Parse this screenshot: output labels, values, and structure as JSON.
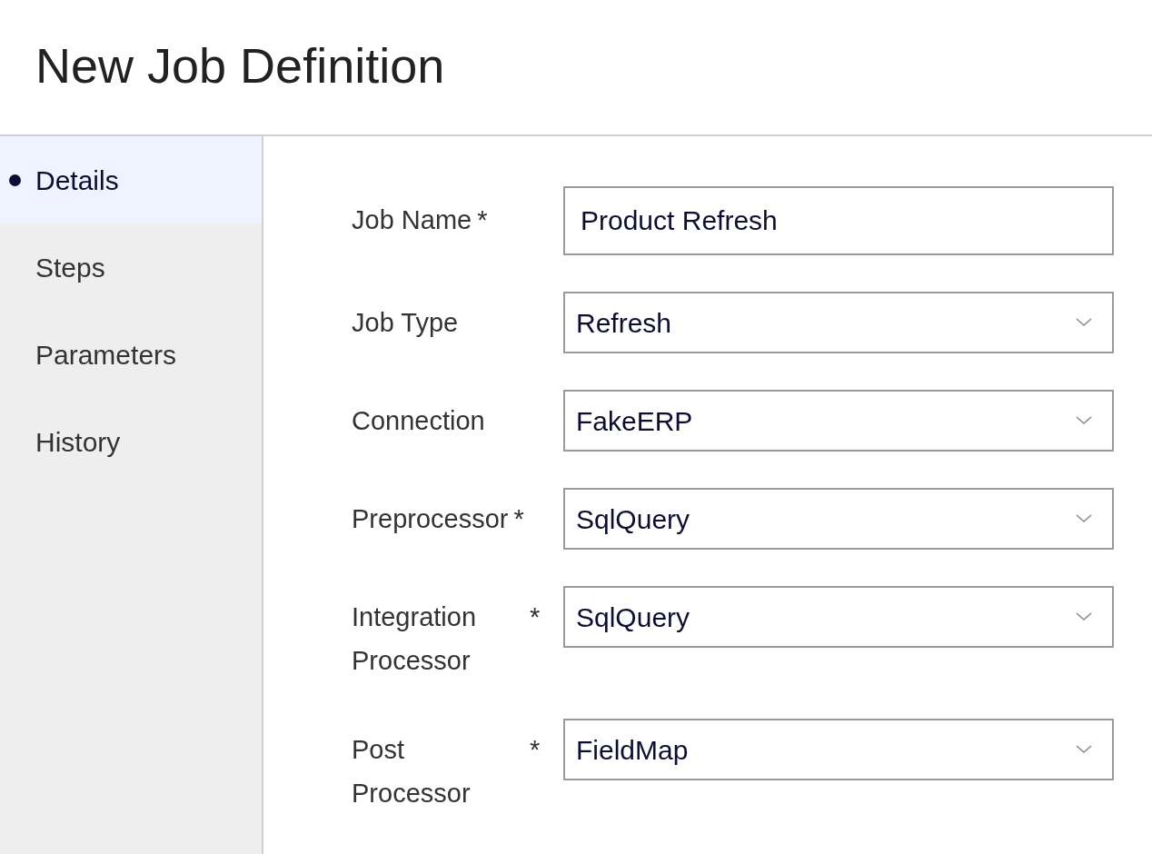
{
  "title": "New Job Definition",
  "nav": [
    {
      "label": "Details",
      "selected": true
    },
    {
      "label": "Steps",
      "selected": false
    },
    {
      "label": "Parameters",
      "selected": false
    },
    {
      "label": "History",
      "selected": false
    }
  ],
  "fields": [
    {
      "label": "Job Name",
      "required": true,
      "kind": "text",
      "value": "Product Refresh"
    },
    {
      "label": "Job Type",
      "required": false,
      "kind": "select",
      "value": "Refresh"
    },
    {
      "label": "Connection",
      "required": false,
      "kind": "select",
      "value": "FakeERP"
    },
    {
      "label": "Preprocessor",
      "required": true,
      "kind": "select",
      "value": "SqlQuery"
    },
    {
      "label": "Integration Processor",
      "required": true,
      "kind": "select",
      "value": "SqlQuery"
    },
    {
      "label": "Post Processor",
      "required": true,
      "kind": "select",
      "value": "FieldMap"
    }
  ],
  "required_mark": "*"
}
